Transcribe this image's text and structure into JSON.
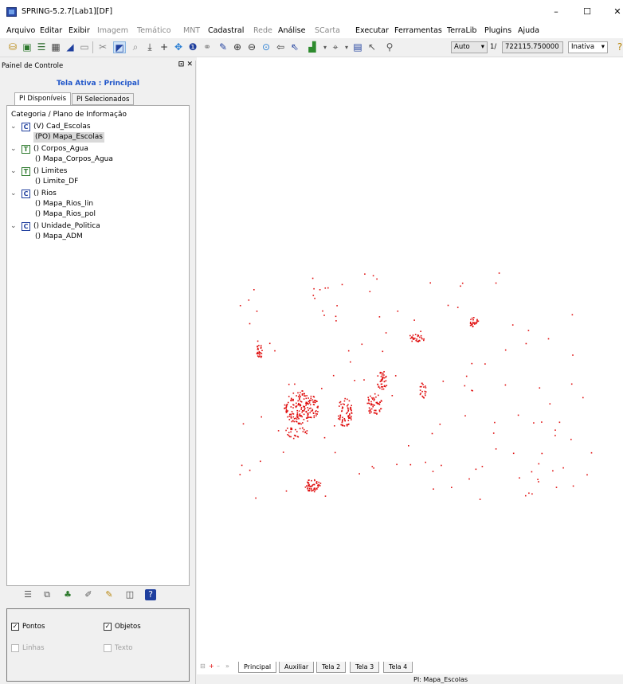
{
  "window": {
    "title": "SPRING-5.2.7[Lab1][DF]",
    "minimize": "–",
    "maximize": "☐",
    "close": "✕"
  },
  "menu": [
    "Arquivo",
    "Editar",
    "Exibir",
    "Imagem",
    "Temático",
    "MNT",
    "Cadastral",
    "Rede",
    "Análise",
    "SCarta",
    "Executar",
    "Ferramentas",
    "TerraLib",
    "Plugins",
    "Ajuda"
  ],
  "toolbar": {
    "mode": "Auto",
    "scale_prefix": "1/",
    "scale_value": "722115.750000",
    "state": "Inativa"
  },
  "panel": {
    "title": "Painel de Controle",
    "active_tela": "Tela Ativa : Principal",
    "tabs": [
      "PI Disponíveis",
      "PI Selecionados"
    ],
    "tree_root": "Categoria / Plano de Informação",
    "categories": [
      {
        "icon": "C",
        "label": "(V) Cad_Escolas",
        "children": [
          "(PO) Mapa_Escolas"
        ]
      },
      {
        "icon": "T",
        "label": "() Corpos_Agua",
        "children": [
          "() Mapa_Corpos_Agua"
        ]
      },
      {
        "icon": "T",
        "label": "() Limites",
        "children": [
          "() Limite_DF"
        ]
      },
      {
        "icon": "C",
        "label": "() Rios",
        "children": [
          "() Mapa_Rios_lin",
          "() Mapa_Rios_pol"
        ]
      },
      {
        "icon": "C",
        "label": "() Unidade_Politica",
        "children": [
          "() Mapa_ADM"
        ]
      }
    ],
    "checkboxes": {
      "pontos": "Pontos",
      "objetos": "Objetos",
      "linhas": "Linhas",
      "texto": "Texto"
    }
  },
  "telas": [
    "Principal",
    "Auxiliar",
    "Tela 2",
    "Tela 3",
    "Tela 4"
  ],
  "status": "PI: Mapa_Escolas",
  "colors": {
    "points": "#e01010",
    "active_tela": "#1f55c9"
  }
}
